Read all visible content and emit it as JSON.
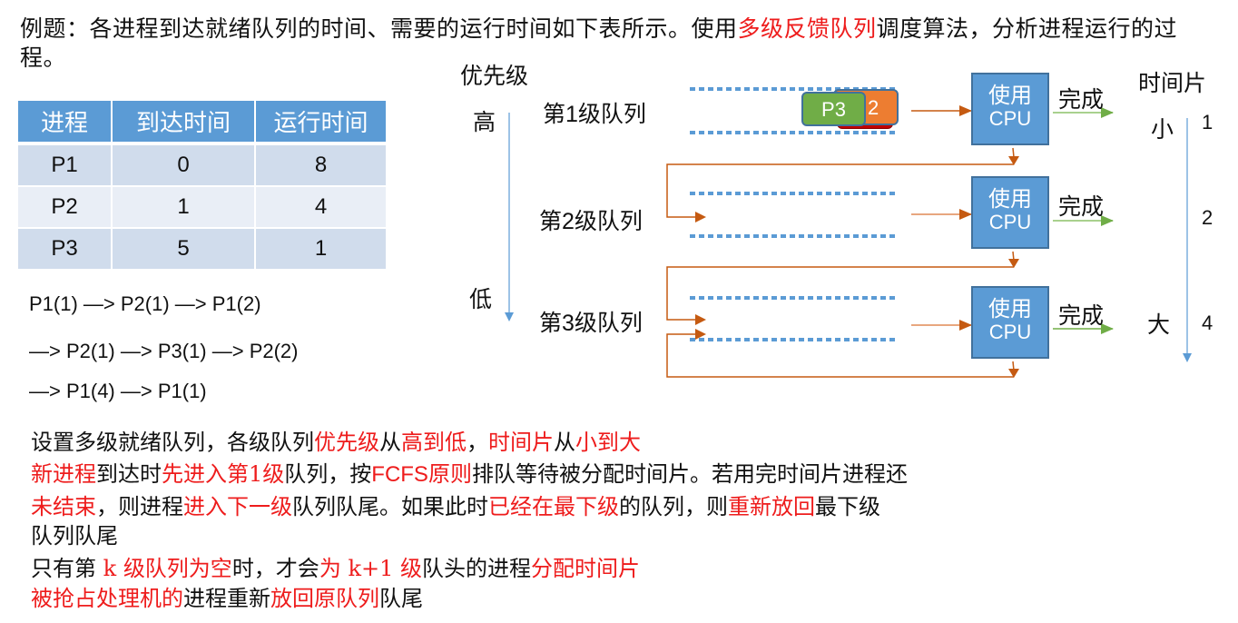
{
  "intro": {
    "parts": [
      {
        "text": "例题：各进程到达就绪队列的时间、需要的运行时间如下表所示。使用",
        "red": false
      },
      {
        "text": "多级反馈队列",
        "red": true
      },
      {
        "text": "调度算法，分析进程运行的过程。",
        "red": false
      }
    ]
  },
  "table": {
    "headers": [
      "进程",
      "到达时间",
      "运行时间"
    ],
    "rows": [
      [
        "P1",
        "0",
        "8"
      ],
      [
        "P2",
        "1",
        "4"
      ],
      [
        "P3",
        "5",
        "1"
      ]
    ]
  },
  "sequence": {
    "lines": [
      "P1(1) —> P2(1) —> P1(2)",
      "—> P2(1) —> P3(1) —> P2(2)",
      "—> P1(4) —> P1(1)"
    ]
  },
  "diagram": {
    "priority_title": "优先级",
    "priority_high": "高",
    "priority_low": "低",
    "timeslice_title": "时间片",
    "timeslice_small": "小",
    "timeslice_large": "大",
    "queues": [
      {
        "label_prefix": "第",
        "level": "1",
        "label_suffix": "级队列",
        "timeslice": "1",
        "cpu_line1": "使用",
        "cpu_line2": "CPU",
        "done": "完成"
      },
      {
        "label_prefix": "第",
        "level": "2",
        "label_suffix": "级队列",
        "timeslice": "2",
        "cpu_line1": "使用",
        "cpu_line2": "CPU",
        "done": "完成"
      },
      {
        "label_prefix": "第",
        "level": "3",
        "label_suffix": "级队列",
        "timeslice": "4",
        "cpu_line1": "使用",
        "cpu_line2": "CPU",
        "done": "完成"
      }
    ],
    "queue1_processes": {
      "front": "P3",
      "behind": "2"
    },
    "colors": {
      "cpu_fill": "#5b9bd5",
      "queue_dots": "#5b9bd5",
      "flow_arrow": "#c55a11",
      "done_arrow": "#70ad47",
      "axis_arrow": "#9dc3e6",
      "chip_green": "#70ad47",
      "chip_orange": "#ed7d31",
      "chip_red": "#c00000",
      "highlight_red": "#ee1c1c"
    }
  },
  "notes": [
    [
      {
        "text": "设置多级就绪队列，各级队列",
        "red": false
      },
      {
        "text": "优先级",
        "red": true
      },
      {
        "text": "从",
        "red": false
      },
      {
        "text": "高到低",
        "red": true
      },
      {
        "text": "，",
        "red": false
      },
      {
        "text": "时间片",
        "red": true
      },
      {
        "text": "从",
        "red": false
      },
      {
        "text": "小到大",
        "red": true
      }
    ],
    [
      {
        "text": "新进程",
        "red": true
      },
      {
        "text": "到达时",
        "red": false
      },
      {
        "text": "先进入第1级",
        "red": true
      },
      {
        "text": "队列，按",
        "red": false
      },
      {
        "text": "FCFS原则",
        "red": true
      },
      {
        "text": "排队等待被分配时间片。若用完时间片进程还",
        "red": false
      }
    ],
    [
      {
        "text": "未结束",
        "red": true
      },
      {
        "text": "，则进程",
        "red": false
      },
      {
        "text": "进入下一级",
        "red": true
      },
      {
        "text": "队列队尾。如果此时",
        "red": false
      },
      {
        "text": "已经在最下级",
        "red": true
      },
      {
        "text": "的队列，则",
        "red": false
      },
      {
        "text": "重新放回",
        "red": true
      },
      {
        "text": "最下级",
        "red": false
      }
    ],
    [
      {
        "text": "队列队尾",
        "red": false
      }
    ],
    [
      {
        "text": "只有第 ",
        "red": false
      },
      {
        "text": "k 级队列为空",
        "red": true
      },
      {
        "text": "时，才会",
        "red": false
      },
      {
        "text": "为 k+1 级",
        "red": true
      },
      {
        "text": "队头的进程",
        "red": false
      },
      {
        "text": "分配时间片",
        "red": true
      }
    ],
    [
      {
        "text": "被抢占处理机的",
        "red": true
      },
      {
        "text": "进程重新",
        "red": false
      },
      {
        "text": "放回原队列",
        "red": true
      },
      {
        "text": "队尾",
        "red": false
      }
    ]
  ]
}
